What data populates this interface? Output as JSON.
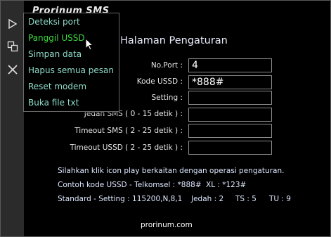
{
  "app": {
    "title": "Prorinum SMS"
  },
  "toolbar": {
    "icons": [
      "play-icon",
      "copy-icon",
      "close-icon"
    ]
  },
  "menu": {
    "items": [
      {
        "label": "Deteksi port"
      },
      {
        "label": "Panggil USSD"
      },
      {
        "label": "Simpan data"
      },
      {
        "label": "Hapus semua pesan"
      },
      {
        "label": "Reset modem"
      },
      {
        "label": "Buka file txt"
      }
    ],
    "active_index": 1
  },
  "settings": {
    "heading": "Halaman Pengaturan",
    "port_label": "No.Port :",
    "port_value": "4",
    "ussd_label": "Kode USSD :",
    "ussd_value": "*888#",
    "setting_label": "Setting :",
    "setting_value": "",
    "jeda_label": "Jedah SMS ( 0 - 15 detik ) :",
    "jeda_value": "",
    "timeout_sms_label": "Timeout SMS ( 2 - 25 detik ) :",
    "timeout_sms_value": "",
    "timeout_ussd_label": "Timeout USSD ( 2 - 25 detik ) :",
    "timeout_ussd_value": ""
  },
  "info": {
    "line1": "Silahkan klik icon play berkaitan dengan operasi pengaturan.",
    "line2_a": "Contoh kode USSD  -  Telkomsel : *888#",
    "line2_b": "XL : *123#",
    "line3_a": "Standard  -  Setting : 115200,N,8,1",
    "line3_b": "Jedah : 2",
    "line3_c": "TS : 5",
    "line3_d": "TU : 9"
  },
  "footer": {
    "text": "prorinum.com"
  },
  "colors": {
    "menu_text": "#8fdcc9",
    "menu_active": "#3ddc3d",
    "background": "#000000"
  }
}
